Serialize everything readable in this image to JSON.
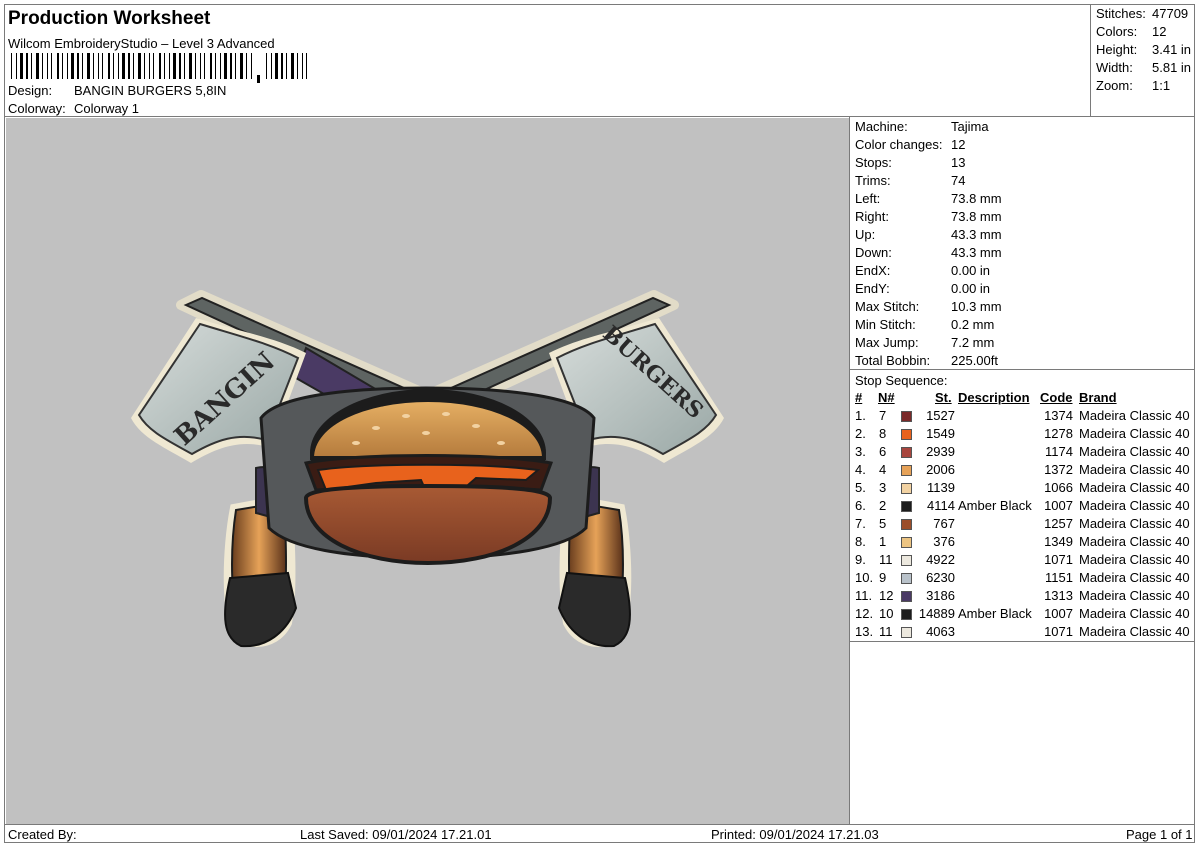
{
  "header": {
    "title": "Production Worksheet",
    "software": "Wilcom EmbroideryStudio – Level 3 Advanced",
    "design_label": "Design:",
    "design_value": "BANGIN BURGERS 5,8IN",
    "colorway_label": "Colorway:",
    "colorway_value": "Colorway 1"
  },
  "summary": [
    {
      "label": "Stitches:",
      "value": "47709"
    },
    {
      "label": "Colors:",
      "value": "12"
    },
    {
      "label": "Height:",
      "value": "3.41 in"
    },
    {
      "label": "Width:",
      "value": "5.81 in"
    },
    {
      "label": "Zoom:",
      "value": "1:1"
    }
  ],
  "machine": [
    {
      "label": "Machine:",
      "value": "Tajima"
    },
    {
      "label": "Color changes:",
      "value": "12"
    },
    {
      "label": "Stops:",
      "value": "13"
    },
    {
      "label": "Trims:",
      "value": "74"
    },
    {
      "label": "Left:",
      "value": "73.8 mm"
    },
    {
      "label": "Right:",
      "value": "73.8 mm"
    },
    {
      "label": "Up:",
      "value": "43.3 mm"
    },
    {
      "label": "Down:",
      "value": "43.3 mm"
    },
    {
      "label": "EndX:",
      "value": "0.00 in"
    },
    {
      "label": "EndY:",
      "value": "0.00 in"
    },
    {
      "label": "Max Stitch:",
      "value": "10.3 mm"
    },
    {
      "label": "Min Stitch:",
      "value": "0.2 mm"
    },
    {
      "label": "Max Jump:",
      "value": "7.2 mm"
    },
    {
      "label": "Total Bobbin:",
      "value": "225.00ft"
    }
  ],
  "stop_sequence": {
    "title": "Stop Sequence:",
    "columns": {
      "num": "#",
      "needle": "N#",
      "stitches": "St.",
      "description": "Description",
      "code": "Code",
      "brand": "Brand"
    },
    "rows": [
      {
        "num": "1.",
        "needle": "7",
        "color": "#7a2a2a",
        "stitches": "1527",
        "description": "",
        "code": "1374",
        "brand": "Madeira Classic 40"
      },
      {
        "num": "2.",
        "needle": "8",
        "color": "#e8621c",
        "stitches": "1549",
        "description": "",
        "code": "1278",
        "brand": "Madeira Classic 40"
      },
      {
        "num": "3.",
        "needle": "6",
        "color": "#a8463e",
        "stitches": "2939",
        "description": "",
        "code": "1174",
        "brand": "Madeira Classic 40"
      },
      {
        "num": "4.",
        "needle": "4",
        "color": "#e6a258",
        "stitches": "2006",
        "description": "",
        "code": "1372",
        "brand": "Madeira Classic 40"
      },
      {
        "num": "5.",
        "needle": "3",
        "color": "#f2d2a2",
        "stitches": "1139",
        "description": "",
        "code": "1066",
        "brand": "Madeira Classic 40"
      },
      {
        "num": "6.",
        "needle": "2",
        "color": "#1c1c1c",
        "stitches": "4114",
        "description": "Amber Black",
        "code": "1007",
        "brand": "Madeira Classic 40"
      },
      {
        "num": "7.",
        "needle": "5",
        "color": "#9b4e2a",
        "stitches": "767",
        "description": "",
        "code": "1257",
        "brand": "Madeira Classic 40"
      },
      {
        "num": "8.",
        "needle": "1",
        "color": "#ecc482",
        "stitches": "376",
        "description": "",
        "code": "1349",
        "brand": "Madeira Classic 40"
      },
      {
        "num": "9.",
        "needle": "11",
        "color": "#ece8de",
        "stitches": "4922",
        "description": "",
        "code": "1071",
        "brand": "Madeira Classic 40"
      },
      {
        "num": "10.",
        "needle": "9",
        "color": "#b9c2ca",
        "stitches": "6230",
        "description": "",
        "code": "1151",
        "brand": "Madeira Classic 40"
      },
      {
        "num": "11.",
        "needle": "12",
        "color": "#4a3a64",
        "stitches": "3186",
        "description": "",
        "code": "1313",
        "brand": "Madeira Classic 40"
      },
      {
        "num": "12.",
        "needle": "10",
        "color": "#1c1c1c",
        "stitches": "14889",
        "description": "Amber Black",
        "code": "1007",
        "brand": "Madeira Classic 40"
      },
      {
        "num": "13.",
        "needle": "11",
        "color": "#ece8de",
        "stitches": "4063",
        "description": "",
        "code": "1071",
        "brand": "Madeira Classic 40"
      }
    ]
  },
  "footer": {
    "created_by": "Created By:",
    "last_saved": "Last Saved: 09/01/2024 17.21.01",
    "printed": "Printed: 09/01/2024 17.21.03",
    "page": "Page 1 of 1"
  },
  "design_preview": {
    "flag_left_text": "BANGIN",
    "flag_right_text": "BURGERS"
  }
}
